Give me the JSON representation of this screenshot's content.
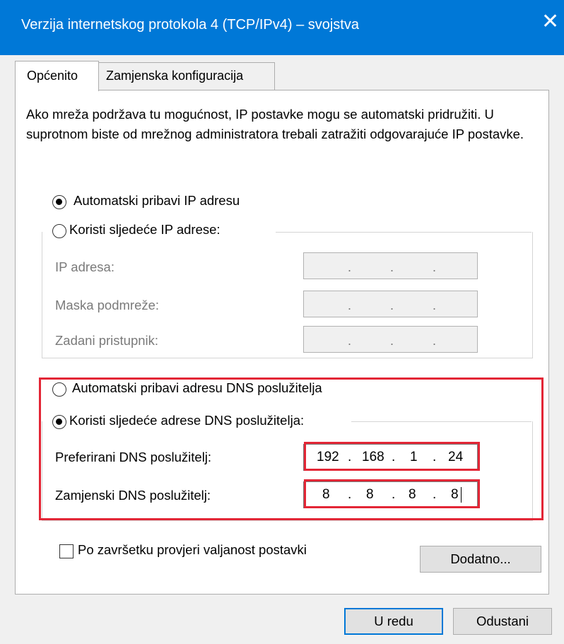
{
  "window": {
    "title": "Verzija internetskog protokola 4 (TCP/IPv4) – svojstva",
    "close_glyph": "✕"
  },
  "tabs": [
    {
      "label": "Općenito",
      "active": true
    },
    {
      "label": "Zamjenska konfiguracija",
      "active": false
    }
  ],
  "intro_text": "Ako mreža podržava tu mogućnost, IP postavke mogu se automatski pridružiti. U suprotnom biste od mrežnog administratora trebali zatražiti odgovarajuće IP postavke.",
  "ip": {
    "auto_label": "Automatski pribavi IP adresu",
    "auto_selected": true,
    "manual_label": "Koristi sljedeće IP adrese:",
    "manual_selected": false,
    "fields": [
      {
        "label": "IP adresa:"
      },
      {
        "label": "Maska podmreže:"
      },
      {
        "label": "Zadani pristupnik:"
      }
    ]
  },
  "dns": {
    "auto_label": "Automatski pribavi adresu DNS poslužitelja",
    "auto_selected": false,
    "manual_label": "Koristi sljedeće adrese DNS poslužitelja:",
    "manual_selected": true,
    "preferred_label": "Preferirani DNS poslužitelj:",
    "preferred_value": [
      "192",
      "168",
      "1",
      "24"
    ],
    "alternate_label": "Zamjenski DNS poslužitelj:",
    "alternate_value": [
      "8",
      "8",
      "8",
      "8"
    ]
  },
  "validate_label": "Po završetku provjeri valjanost postavki",
  "validate_checked": false,
  "buttons": {
    "advanced": "Dodatno...",
    "ok": "U redu",
    "cancel": "Odustani"
  },
  "colors": {
    "titlebar": "#0078d7",
    "highlight": "#e32636"
  }
}
